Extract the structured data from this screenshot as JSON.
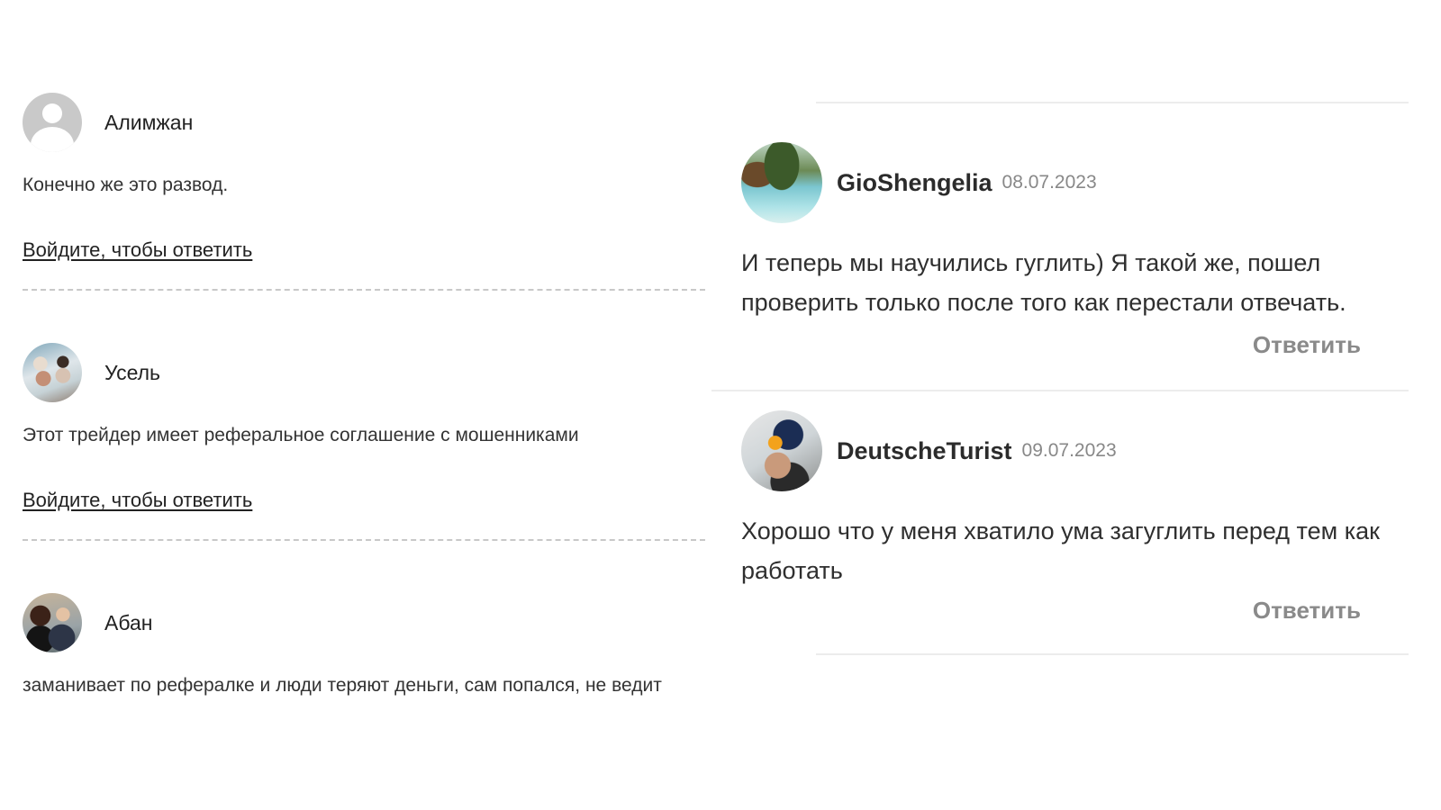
{
  "left_comments": [
    {
      "author": "Алимжан",
      "text": "Конечно же это развод.",
      "reply_link": "Войдите, чтобы ответить"
    },
    {
      "author": "Усель",
      "text": "Этот трейдер имеет реферальное соглашение с мошенниками",
      "reply_link": "Войдите, чтобы ответить"
    },
    {
      "author": "Абан",
      "text": "заманивает по рефералке и люди теряют деньги, сам попался, не ведит"
    }
  ],
  "right_comments": [
    {
      "author": "GioShengelia",
      "date": "08.07.2023",
      "text": "И теперь мы научились гуглить) Я такой же, пошел проверить только после того как перестали отвечать.",
      "reply_label": "Ответить"
    },
    {
      "author": "DeutscheTurist",
      "date": "09.07.2023",
      "text": "Хорошо что у меня хватило ума загуглить перед тем как работать",
      "reply_label": "Ответить"
    }
  ]
}
